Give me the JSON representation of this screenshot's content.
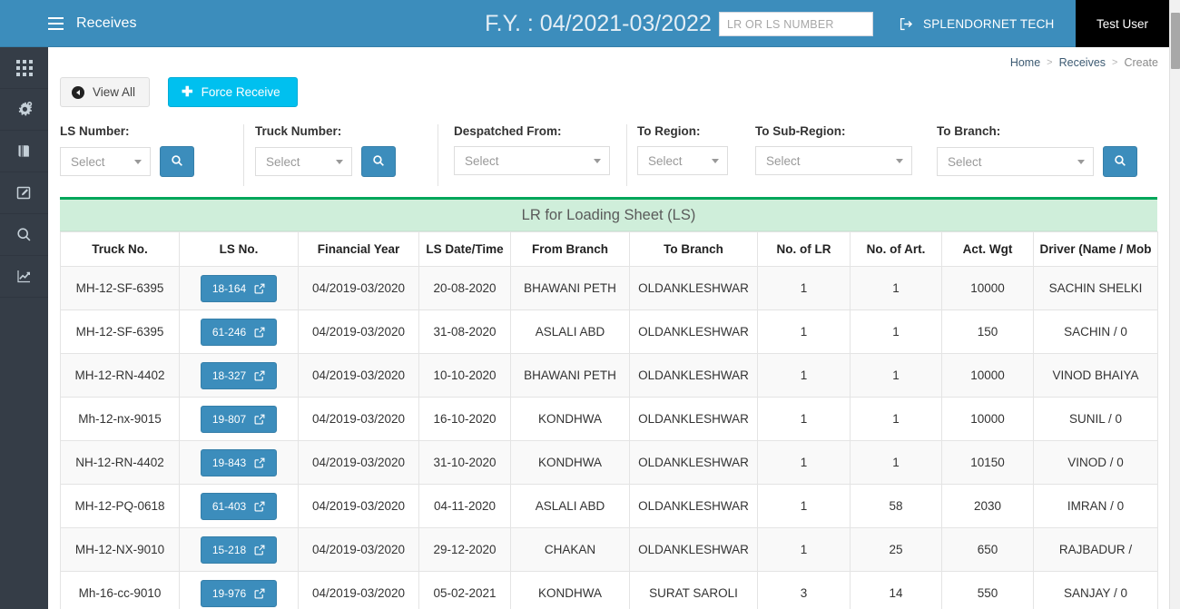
{
  "navbar": {
    "menu_icon": "hamburger-icon",
    "title": "Receives",
    "financial_year": "F.Y. : 04/2021-03/2022",
    "search_placeholder": "LR OR LS NUMBER",
    "search_value": "",
    "signout_icon": "sign-out-icon",
    "company": "SPLENDORNET TECH",
    "user": "Test User",
    "brand_color": "#3c8dbc"
  },
  "sidebar": {
    "items": [
      {
        "icon": "grid-apps-icon",
        "name": "sidebar-item-dashboard"
      },
      {
        "icon": "cogs-icon",
        "name": "sidebar-item-settings"
      },
      {
        "icon": "book-icon",
        "name": "sidebar-item-masters"
      },
      {
        "icon": "pencil-square-icon",
        "name": "sidebar-item-entry"
      },
      {
        "icon": "search-icon",
        "name": "sidebar-item-search"
      },
      {
        "icon": "chart-line-icon",
        "name": "sidebar-item-reports"
      }
    ]
  },
  "breadcrumb": {
    "items": [
      "Home",
      "Receives",
      "Create"
    ],
    "separator": ">"
  },
  "toolbar": {
    "view_all_label": "View All",
    "view_all_icon": "arrow-circle-left-icon",
    "force_receive_label": "Force Receive",
    "force_receive_icon": "plus-icon",
    "force_receive_color": "#00c0ef"
  },
  "filters": [
    {
      "label": "LS Number:",
      "value": "Select",
      "has_search_button": true
    },
    {
      "label": "Truck Number:",
      "value": "Select",
      "has_search_button": true
    },
    {
      "label": "Despatched From:",
      "value": "Select",
      "has_search_button": false
    },
    {
      "label": "To Region:",
      "value": "Select",
      "has_search_button": false
    },
    {
      "label": "To Sub-Region:",
      "value": "Select",
      "has_search_button": false
    },
    {
      "label": "To Branch:",
      "value": "Select",
      "has_search_button": true
    }
  ],
  "panel": {
    "title": "LR for Loading Sheet (LS)",
    "accent_color": "#00a65a",
    "header_bg": "#cfeeda"
  },
  "table": {
    "columns": [
      "Truck No.",
      "LS No.",
      "Financial Year",
      "LS Date/Time",
      "From Branch",
      "To Branch",
      "No. of LR",
      "No. of Art.",
      "Act. Wgt",
      "Driver (Name / Mob"
    ],
    "rows": [
      {
        "truck_no": "MH-12-SF-6395",
        "ls_no": "18-164",
        "financial_year": "04/2019-03/2020",
        "ls_date": "20-08-2020",
        "from_branch": "BHAWANI PETH",
        "to_branch": "OLDANKLESHWAR",
        "no_of_lr": "1",
        "no_of_art": "1",
        "act_wgt": "10000",
        "driver": "SACHIN SHELKI"
      },
      {
        "truck_no": "MH-12-SF-6395",
        "ls_no": "61-246",
        "financial_year": "04/2019-03/2020",
        "ls_date": "31-08-2020",
        "from_branch": "ASLALI ABD",
        "to_branch": "OLDANKLESHWAR",
        "no_of_lr": "1",
        "no_of_art": "1",
        "act_wgt": "150",
        "driver": "SACHIN / 0"
      },
      {
        "truck_no": "MH-12-RN-4402",
        "ls_no": "18-327",
        "financial_year": "04/2019-03/2020",
        "ls_date": "10-10-2020",
        "from_branch": "BHAWANI PETH",
        "to_branch": "OLDANKLESHWAR",
        "no_of_lr": "1",
        "no_of_art": "1",
        "act_wgt": "10000",
        "driver": "VINOD BHAIYA"
      },
      {
        "truck_no": "Mh-12-nx-9015",
        "ls_no": "19-807",
        "financial_year": "04/2019-03/2020",
        "ls_date": "16-10-2020",
        "from_branch": "KONDHWA",
        "to_branch": "OLDANKLESHWAR",
        "no_of_lr": "1",
        "no_of_art": "1",
        "act_wgt": "10000",
        "driver": "SUNIL / 0"
      },
      {
        "truck_no": "NH-12-RN-4402",
        "ls_no": "19-843",
        "financial_year": "04/2019-03/2020",
        "ls_date": "31-10-2020",
        "from_branch": "KONDHWA",
        "to_branch": "OLDANKLESHWAR",
        "no_of_lr": "1",
        "no_of_art": "1",
        "act_wgt": "10150",
        "driver": "VINOD / 0"
      },
      {
        "truck_no": "MH-12-PQ-0618",
        "ls_no": "61-403",
        "financial_year": "04/2019-03/2020",
        "ls_date": "04-11-2020",
        "from_branch": "ASLALI ABD",
        "to_branch": "OLDANKLESHWAR",
        "no_of_lr": "1",
        "no_of_art": "58",
        "act_wgt": "2030",
        "driver": "IMRAN / 0"
      },
      {
        "truck_no": "MH-12-NX-9010",
        "ls_no": "15-218",
        "financial_year": "04/2019-03/2020",
        "ls_date": "29-12-2020",
        "from_branch": "CHAKAN",
        "to_branch": "OLDANKLESHWAR",
        "no_of_lr": "1",
        "no_of_art": "25",
        "act_wgt": "650",
        "driver": "RAJBADUR /"
      },
      {
        "truck_no": "Mh-16-cc-9010",
        "ls_no": "19-976",
        "financial_year": "04/2019-03/2020",
        "ls_date": "05-02-2021",
        "from_branch": "KONDHWA",
        "to_branch": "SURAT SAROLI",
        "no_of_lr": "3",
        "no_of_art": "14",
        "act_wgt": "550",
        "driver": "SANJAY / 0"
      }
    ]
  }
}
